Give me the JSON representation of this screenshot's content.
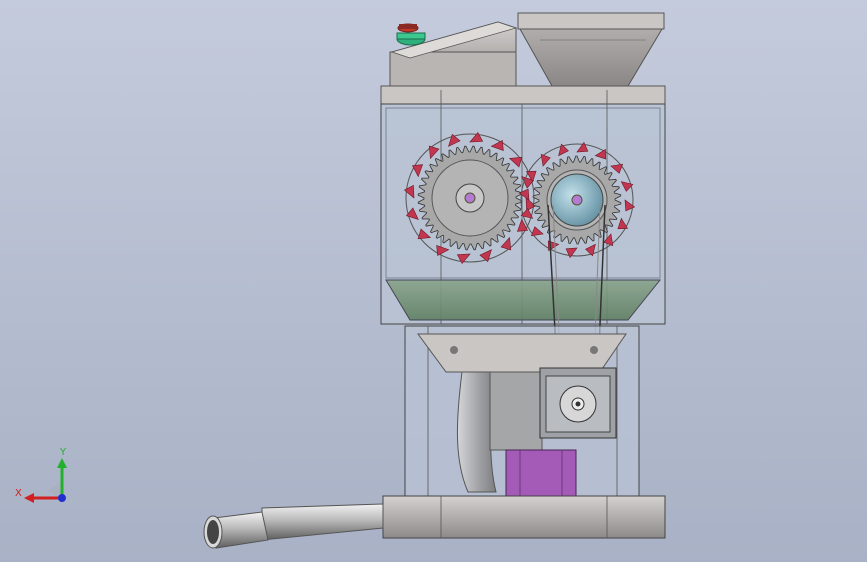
{
  "viewport": {
    "background_top": "#c4cbdc",
    "background_bottom": "#a9b1c6"
  },
  "model": {
    "parts": [
      "control-box",
      "emergency-stop-button",
      "feed-hopper",
      "crusher-housing",
      "left-gear",
      "right-gear",
      "drive-belt",
      "motor-pulley",
      "motor",
      "discharge-chute",
      "discharge-pipe",
      "base-plate",
      "frame"
    ],
    "colors": {
      "body_gray": "#9a9796",
      "body_light": "#c9c6c4",
      "glass": "#b9c3d4",
      "gear_gray": "#a8a8a8",
      "blade_red": "#c2364f",
      "hub_purple": "#b57ad3",
      "hub_teal": "#7aa8b8",
      "motor_purple": "#a45ab7",
      "green_tray": "#6c8c6e",
      "button_green": "#2fb07c",
      "button_red": "#c0392b"
    }
  },
  "triad": {
    "x_label": "X",
    "y_label": "Y",
    "x_color": "#d21f1f",
    "y_color": "#24b02f",
    "z_color": "#2030d0"
  }
}
